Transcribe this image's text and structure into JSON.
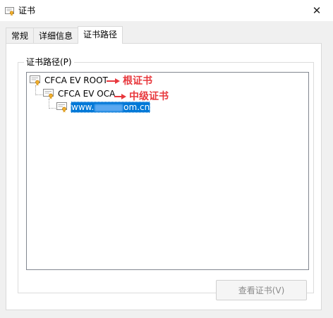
{
  "window": {
    "title": "证书",
    "close_glyph": "✕"
  },
  "tabs": [
    {
      "label": "常规",
      "active": false
    },
    {
      "label": "详细信息",
      "active": false
    },
    {
      "label": "证书路径",
      "active": true
    }
  ],
  "cert_path": {
    "group_label": "证书路径(P)",
    "nodes": [
      {
        "label": "CFCA EV ROOT",
        "icon": "certificate-icon",
        "annotation": "根证书"
      },
      {
        "label": "CFCA EV OCA",
        "icon": "certificate-icon",
        "annotation": "中级证书"
      },
      {
        "label_prefix": "www.",
        "label_suffix": "om.cn",
        "icon": "certificate-icon",
        "selected": true
      }
    ]
  },
  "buttons": {
    "view_cert": "查看证书(V)"
  },
  "colors": {
    "selection": "#0078d7",
    "annotation": "#e8383d"
  }
}
